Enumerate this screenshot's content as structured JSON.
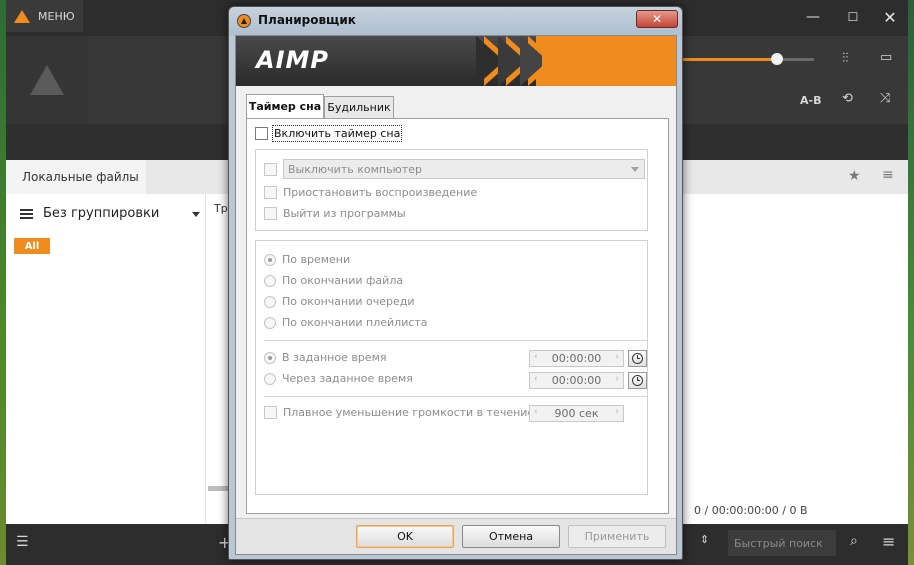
{
  "main": {
    "menu_label": "МЕНЮ",
    "ab_label": "A-B",
    "volume": 0.72,
    "local_files_tab": "Локальные файлы",
    "grouping_label": "Без группировки",
    "all_badge": "All",
    "track_col": "Тр",
    "stats_text": "0 / 00:00:00:00 / 0 B",
    "search_placeholder": "Быстрый поиск"
  },
  "dialog": {
    "title": "Планировщик",
    "close_label": "✕",
    "banner_text": "AIMP",
    "tabs": [
      {
        "label": "Таймер сна"
      },
      {
        "label": "Будильник"
      }
    ],
    "enable_timer_label": "Включить таймер сна",
    "action_combo_value": "Выключить компьютер",
    "pause_label": "Приостановить воспроизведение",
    "exit_label": "Выйти из программы",
    "radios": {
      "by_time": "По времени",
      "end_file": "По окончании файла",
      "end_queue": "По окончании очереди",
      "end_playlist": "По окончании плейлиста",
      "at_time": "В заданное время",
      "after_time": "Через заданное время"
    },
    "at_time_value": "00:00:00",
    "after_time_value": "00:00:00",
    "fade_label": "Плавное уменьшение громкости в течение:",
    "fade_value": "900 сек",
    "buttons": {
      "ok": "OK",
      "cancel": "Отмена",
      "apply": "Применить"
    }
  }
}
